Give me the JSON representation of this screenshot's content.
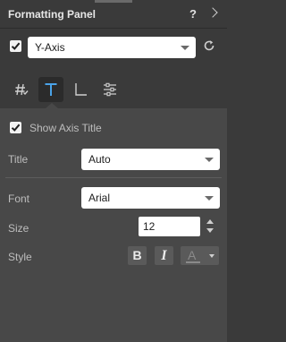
{
  "panel": {
    "title": "Formatting Panel",
    "help_label": "?"
  },
  "axis_selector": {
    "enabled": true,
    "selected": "Y-Axis"
  },
  "tabs": [
    {
      "name": "number-format",
      "icon": "hash-icon",
      "active": false
    },
    {
      "name": "text",
      "icon": "text-T-icon",
      "active": true
    },
    {
      "name": "axis",
      "icon": "axis-icon",
      "active": false
    },
    {
      "name": "settings",
      "icon": "sliders-icon",
      "active": false
    }
  ],
  "text_section": {
    "show_axis_title_label": "Show Axis Title",
    "show_axis_title_checked": true,
    "title_label": "Title",
    "title_value": "Auto",
    "font_label": "Font",
    "font_value": "Arial",
    "size_label": "Size",
    "size_value": "12",
    "style_label": "Style",
    "bold_label": "B",
    "italic_label": "I",
    "color_label": "A"
  },
  "colors": {
    "panel_bg": "#3a3a3a",
    "body_bg": "#484848",
    "accent_blue": "#4aa3e8"
  }
}
